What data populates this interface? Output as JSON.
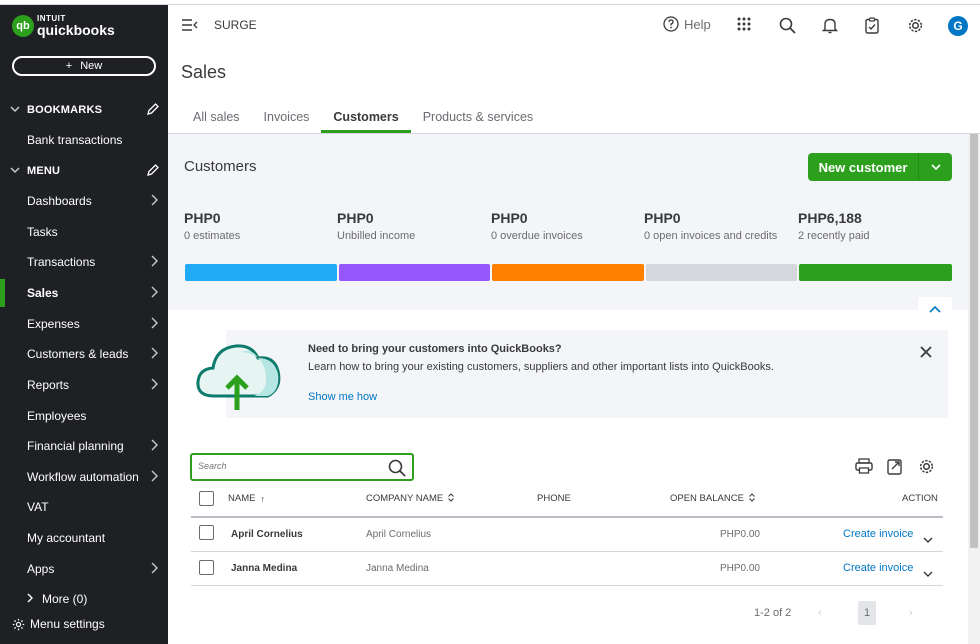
{
  "brand": {
    "line1": "INTUIT",
    "line2": "quickbooks",
    "badge": "qb"
  },
  "sidebar": {
    "new_label": "New",
    "bookmarks_header": "BOOKMARKS",
    "bookmarks": [
      {
        "label": "Bank transactions"
      }
    ],
    "menu_header": "MENU",
    "items": [
      {
        "label": "Dashboards",
        "has_arrow": true
      },
      {
        "label": "Tasks",
        "has_arrow": false
      },
      {
        "label": "Transactions",
        "has_arrow": true
      },
      {
        "label": "Sales",
        "has_arrow": true,
        "active": true
      },
      {
        "label": "Expenses",
        "has_arrow": true
      },
      {
        "label": "Customers & leads",
        "has_arrow": true
      },
      {
        "label": "Reports",
        "has_arrow": true
      },
      {
        "label": "Employees",
        "has_arrow": false
      },
      {
        "label": "Financial planning",
        "has_arrow": true
      },
      {
        "label": "Workflow automation",
        "has_arrow": true
      },
      {
        "label": "VAT",
        "has_arrow": false
      },
      {
        "label": "My accountant",
        "has_arrow": false
      },
      {
        "label": "Apps",
        "has_arrow": true
      }
    ],
    "more_label": "More (0)",
    "settings_label": "Menu settings"
  },
  "topbar": {
    "company": "SURGE",
    "help_label": "Help",
    "avatar_initial": "G"
  },
  "page": {
    "title": "Sales",
    "tabs": [
      {
        "label": "All sales",
        "active": false
      },
      {
        "label": "Invoices",
        "active": false
      },
      {
        "label": "Customers",
        "active": true
      },
      {
        "label": "Products & services",
        "active": false
      }
    ]
  },
  "summary": {
    "title": "Customers",
    "new_customer_label": "New customer",
    "stats": [
      {
        "amount": "PHP0",
        "desc": "0 estimates",
        "color": "#21abf6"
      },
      {
        "amount": "PHP0",
        "desc": "Unbilled income",
        "color": "#9457fa"
      },
      {
        "amount": "PHP0",
        "desc": "0 overdue invoices",
        "color": "#ff8000"
      },
      {
        "amount": "PHP0",
        "desc": "0 open invoices and credits",
        "color": "#d4d7dc"
      },
      {
        "amount": "PHP6,188",
        "desc": "2 recently paid",
        "color": "#2ca01c"
      }
    ]
  },
  "banner": {
    "title": "Need to bring your customers into QuickBooks?",
    "description": "Learn how to bring your existing customers, suppliers and other important lists into QuickBooks.",
    "link": "Show me how"
  },
  "table": {
    "search_placeholder": "Search",
    "columns": {
      "name": "NAME",
      "company": "COMPANY NAME",
      "phone": "PHONE",
      "balance": "OPEN BALANCE",
      "action": "ACTION"
    },
    "rows": [
      {
        "name": "April Cornelius",
        "company": "April Cornelius",
        "phone": "",
        "balance": "PHP0.00",
        "action": "Create invoice"
      },
      {
        "name": "Janna Medina",
        "company": "Janna Medina",
        "phone": "",
        "balance": "PHP0.00",
        "action": "Create invoice"
      }
    ],
    "pagination": {
      "range": "1-2 of 2",
      "current_page": "1",
      "prev": "‹",
      "next": "›"
    }
  },
  "colors": {
    "brand_green": "#2ca01c",
    "link_blue": "#0077c5",
    "sidebar_bg": "#1e2023"
  }
}
